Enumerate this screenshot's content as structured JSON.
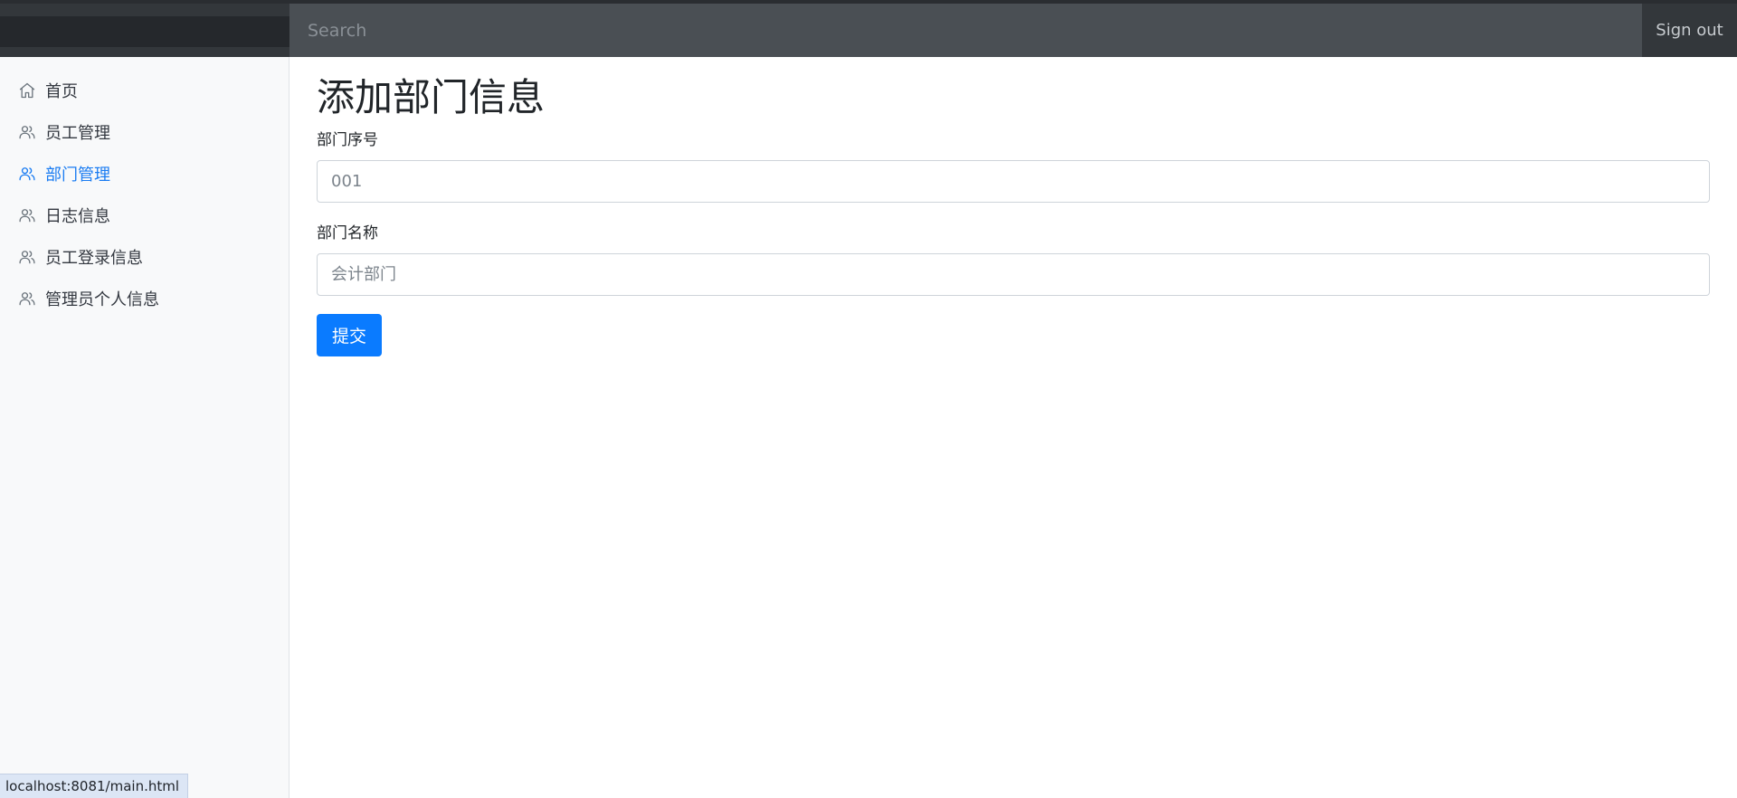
{
  "header": {
    "search_placeholder": "Search",
    "signout_label": "Sign out"
  },
  "sidebar": {
    "items": [
      {
        "label": "首页",
        "icon": "home-icon",
        "active": false
      },
      {
        "label": "员工管理",
        "icon": "users-icon",
        "active": false
      },
      {
        "label": "部门管理",
        "icon": "users-icon",
        "active": true
      },
      {
        "label": "日志信息",
        "icon": "users-icon",
        "active": false
      },
      {
        "label": "员工登录信息",
        "icon": "users-icon",
        "active": false
      },
      {
        "label": "管理员个人信息",
        "icon": "users-icon",
        "active": false
      }
    ]
  },
  "main": {
    "title": "添加部门信息",
    "form": {
      "dept_id_label": "部门序号",
      "dept_id_placeholder": "001",
      "dept_name_label": "部门名称",
      "dept_name_placeholder": "会计部门",
      "submit_label": "提交"
    }
  },
  "status": {
    "url": "localhost:8081/main.html"
  },
  "colors": {
    "accent": "#0a7bff",
    "topbar": "#4a4f54",
    "sidebar_bg": "#f8f9fa"
  }
}
